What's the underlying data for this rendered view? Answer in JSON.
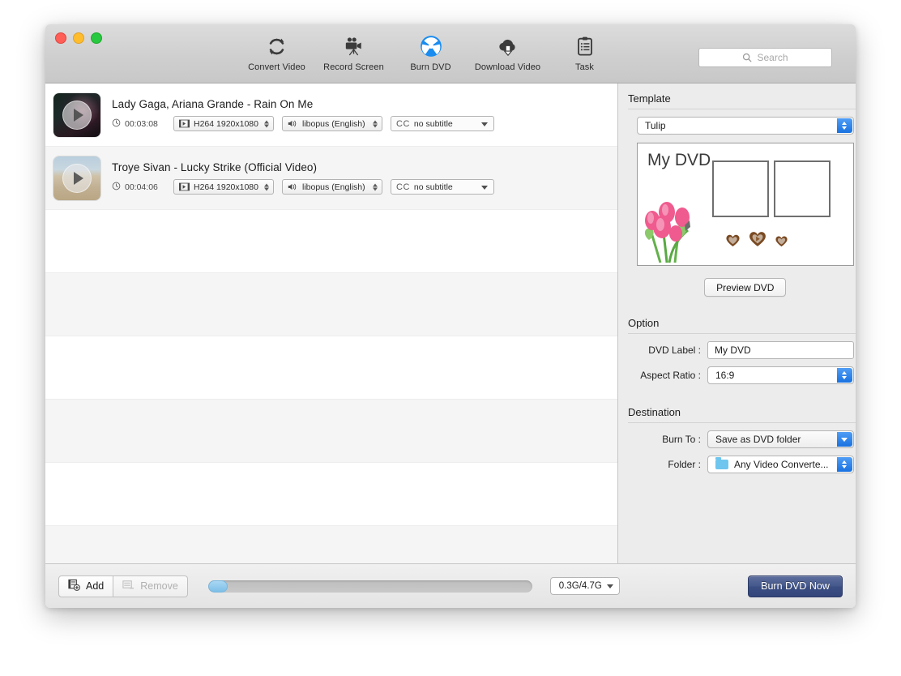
{
  "window": {
    "traffic_lights": [
      "close",
      "minimize",
      "zoom"
    ]
  },
  "toolbar": {
    "items": [
      {
        "label": "Convert Video",
        "icon": "convert-icon",
        "active": false
      },
      {
        "label": "Record Screen",
        "icon": "camera-icon",
        "active": false
      },
      {
        "label": "Burn DVD",
        "icon": "burn-dvd-icon",
        "active": true
      },
      {
        "label": "Download Video",
        "icon": "cloud-download-icon",
        "active": false
      },
      {
        "label": "Task",
        "icon": "clipboard-icon",
        "active": false
      }
    ],
    "search": {
      "placeholder": "Search",
      "value": ""
    }
  },
  "list": {
    "items": [
      {
        "title": "Lady Gaga, Ariana Grande - Rain On Me",
        "duration": "00:03:08",
        "video": "H264 1920x1080",
        "audio": "libopus (English)",
        "subtitle_tag": "CC",
        "subtitle": "no subtitle"
      },
      {
        "title": "Troye Sivan - Lucky Strike (Official Video)",
        "duration": "00:04:06",
        "video": "H264 1920x1080",
        "audio": "libopus (English)",
        "subtitle_tag": "CC",
        "subtitle": "no subtitle"
      }
    ],
    "empty_row_count": 6
  },
  "sidebar": {
    "template": {
      "section_title": "Template",
      "selected": "Tulip",
      "preview_title": "My DVD",
      "preview_button": "Preview DVD"
    },
    "option": {
      "section_title": "Option",
      "dvd_label_caption": "DVD Label :",
      "dvd_label_value": "My DVD",
      "aspect_caption": "Aspect Ratio :",
      "aspect_value": "16:9"
    },
    "destination": {
      "section_title": "Destination",
      "burn_to_caption": "Burn To :",
      "burn_to_value": "Save as DVD folder",
      "folder_caption": "Folder :",
      "folder_value": "Any Video Converte..."
    }
  },
  "bottom": {
    "add_label": "Add",
    "remove_label": "Remove",
    "size_value": "0.3G/4.7G",
    "burn_label": "Burn DVD Now",
    "progress_percent": 5
  },
  "colors": {
    "accent_blue": "#1a72e0",
    "burn_icon_blue": "#1a8cf0",
    "burn_button": "#3c4f84",
    "folder_blue": "#6ec6ef"
  }
}
